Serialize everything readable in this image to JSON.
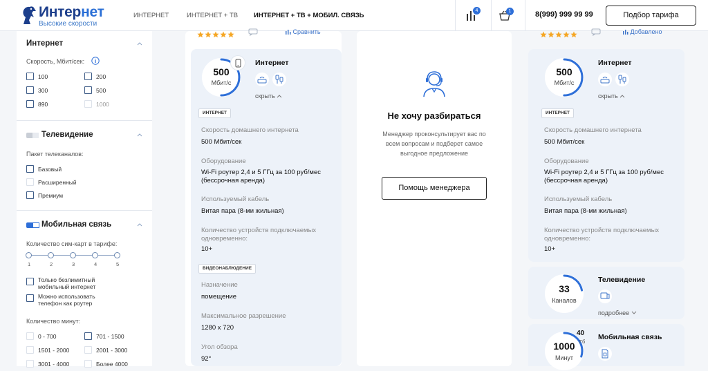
{
  "header": {
    "brand_main": "Интер",
    "brand_accent": "нет",
    "slogan": "Высокие скорости",
    "nav": [
      "ИНТЕРНЕТ",
      "ИНТЕРНЕТ + ТВ",
      "ИНТЕРНЕТ + ТВ + МОБИЛ. СВЯЗЬ"
    ],
    "compare_count": "4",
    "cart_count": "1",
    "phone": "8(999) 999 99 99",
    "pick_button": "Подбор тарифа"
  },
  "sidebar": {
    "internet": {
      "title": "Интернет",
      "speed_label": "Скорость, Мбит/сек:",
      "options": [
        "100",
        "200",
        "300",
        "500",
        "890",
        "1000"
      ]
    },
    "tv": {
      "title": "Телевидение",
      "package_label": "Пакет телеканалов:",
      "options": [
        "Базовый",
        "Расширенный",
        "Премиум"
      ]
    },
    "mobile": {
      "title": "Мобильная связь",
      "sim_label": "Количество сим-карт в тарифе:",
      "sim_values": [
        "1",
        "2",
        "3",
        "4",
        "5"
      ],
      "unlimited_line1": "Только безлимитный",
      "unlimited_line2": "мобильный интернет",
      "router_line1": "Можно использовать",
      "router_line2": "телефон как роутер",
      "minutes_label": "Количество минут:",
      "minutes_options": [
        "0 - 700",
        "701 - 1500",
        "1501 - 2000",
        "2001 - 3000",
        "3001 - 4000",
        "Более 4000"
      ]
    }
  },
  "card1": {
    "compare_link": "Сравнить",
    "rating": 5,
    "speed_value": "500",
    "speed_unit": "Мбит/с",
    "speed_fraction": 0.5,
    "section_title": "Интернет",
    "hide_link": "скрыть",
    "tag_internet": "ИНТЕРНЕТ",
    "speed_label": "Скорость домашнего интернета",
    "speed_text": "500 Мбит/сек",
    "equip_label": "Оборудование",
    "equip_line1": "Wi-Fi роутер 2,4 и 5 ГГц за 100 руб/мес",
    "equip_line2": "(бессрочная аренда)",
    "cable_label": "Используемый кабель",
    "cable_value": "Витая пара (8-ми жильная)",
    "devices_line1": "Количество устройств подключаемых",
    "devices_line2": "одновременно:",
    "devices_value": "10+",
    "tag_video": "ВИДЕОНАБЛЮДЕНИЕ",
    "purpose_label": "Назначение",
    "purpose_value": "помещение",
    "resolution_label": "Максимальное разрешение",
    "resolution_value": "1280 x 720",
    "angle_label": "Угол обзора",
    "angle_value": "92°"
  },
  "middle": {
    "title": "Не хочу разбираться",
    "desc_line1": "Менеджер проконсультирует вас по",
    "desc_line2": "всем вопросам и подберет самое",
    "desc_line3": "выгодное предложение",
    "button": "Помощь менеджера"
  },
  "card3": {
    "added_link": "Добавлено",
    "rating": 5,
    "speed_value": "500",
    "speed_unit": "Мбит/с",
    "speed_fraction": 0.5,
    "section_title": "Интернет",
    "hide_link": "скрыть",
    "tag_internet": "ИНТЕРНЕТ",
    "speed_label": "Скорость домашнего интернета",
    "speed_text": "500 Мбит/сек",
    "equip_label": "Оборудование",
    "equip_line1": "Wi-Fi роутер 2,4 и 5 ГГц за 100 руб/мес",
    "equip_line2": "(бессрочная аренда)",
    "cable_label": "Используемый кабель",
    "cable_value": "Витая пара (8-ми жильная)",
    "devices_line1": "Количество устройств подключаемых",
    "devices_line2": "одновременно:",
    "devices_value": "10+",
    "tv_value": "33",
    "tv_unit": "Каналов",
    "tv_fraction": 0.22,
    "tv_title": "Телевидение",
    "more_link": "подробнее",
    "minutes_value": "1000",
    "minutes_unit": "Минут",
    "gb_value": "40",
    "gb_unit": "Гб",
    "mobile_title": "Мобильная связь"
  },
  "colors": {
    "accent": "#2e6fd8",
    "star": "#f5a623",
    "brand": "#1d3f8c"
  }
}
